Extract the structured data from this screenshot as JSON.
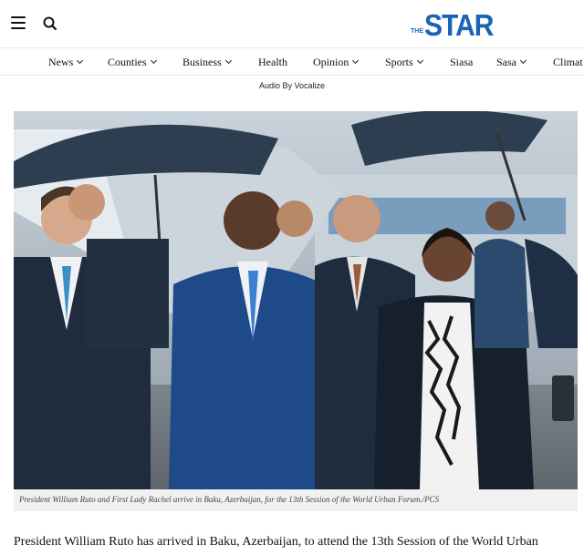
{
  "header": {
    "menu_icon": "hamburger-menu-icon",
    "search_icon": "search-icon",
    "logo_prefix": "THE",
    "logo_text": "STAR",
    "brand_color": "#1a63b5"
  },
  "nav": {
    "items": [
      {
        "label": "News",
        "has_dropdown": true
      },
      {
        "label": "Counties",
        "has_dropdown": true
      },
      {
        "label": "Business",
        "has_dropdown": true
      },
      {
        "label": "Health",
        "has_dropdown": false
      },
      {
        "label": "Opinion",
        "has_dropdown": true
      },
      {
        "label": "Sports",
        "has_dropdown": true
      },
      {
        "label": "Siasa",
        "has_dropdown": false
      },
      {
        "label": "Sasa",
        "has_dropdown": true
      },
      {
        "label": "Climat",
        "has_dropdown": false
      }
    ]
  },
  "audio": {
    "label": "Audio By Vocalize"
  },
  "article": {
    "image_caption": "President William Ruto and First Lady Rachel arrive in Baku, Azerbaijan, for the 13th Session of the World Urban Forum./PCS",
    "lead_text": "President William Ruto has arrived in Baku, Azerbaijan, to attend the 13th Session of the World Urban"
  }
}
